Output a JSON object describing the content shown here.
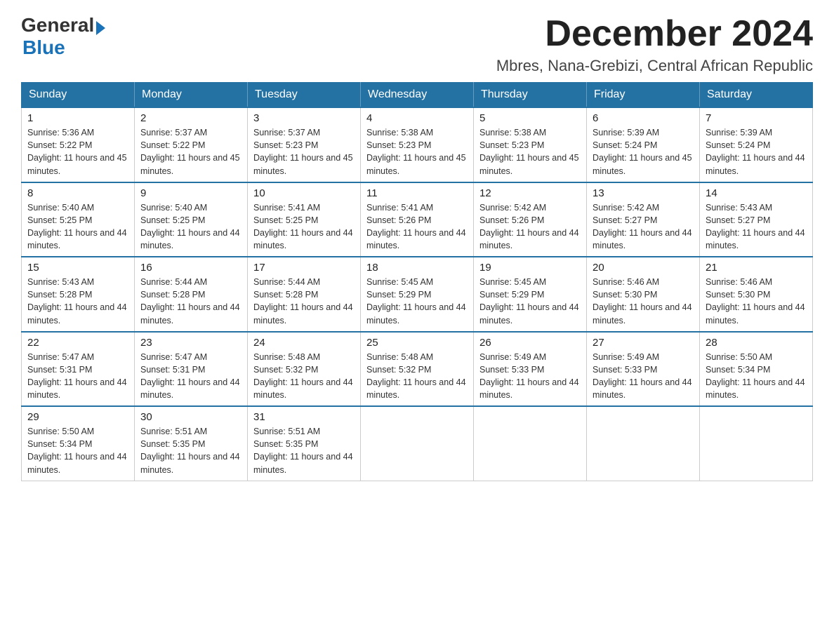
{
  "logo": {
    "general": "General",
    "blue": "Blue"
  },
  "header": {
    "month_year": "December 2024",
    "location": "Mbres, Nana-Grebizi, Central African Republic"
  },
  "days_of_week": [
    "Sunday",
    "Monday",
    "Tuesday",
    "Wednesday",
    "Thursday",
    "Friday",
    "Saturday"
  ],
  "weeks": [
    [
      {
        "day": "1",
        "sunrise": "5:36 AM",
        "sunset": "5:22 PM",
        "daylight": "11 hours and 45 minutes."
      },
      {
        "day": "2",
        "sunrise": "5:37 AM",
        "sunset": "5:22 PM",
        "daylight": "11 hours and 45 minutes."
      },
      {
        "day": "3",
        "sunrise": "5:37 AM",
        "sunset": "5:23 PM",
        "daylight": "11 hours and 45 minutes."
      },
      {
        "day": "4",
        "sunrise": "5:38 AM",
        "sunset": "5:23 PM",
        "daylight": "11 hours and 45 minutes."
      },
      {
        "day": "5",
        "sunrise": "5:38 AM",
        "sunset": "5:23 PM",
        "daylight": "11 hours and 45 minutes."
      },
      {
        "day": "6",
        "sunrise": "5:39 AM",
        "sunset": "5:24 PM",
        "daylight": "11 hours and 45 minutes."
      },
      {
        "day": "7",
        "sunrise": "5:39 AM",
        "sunset": "5:24 PM",
        "daylight": "11 hours and 44 minutes."
      }
    ],
    [
      {
        "day": "8",
        "sunrise": "5:40 AM",
        "sunset": "5:25 PM",
        "daylight": "11 hours and 44 minutes."
      },
      {
        "day": "9",
        "sunrise": "5:40 AM",
        "sunset": "5:25 PM",
        "daylight": "11 hours and 44 minutes."
      },
      {
        "day": "10",
        "sunrise": "5:41 AM",
        "sunset": "5:25 PM",
        "daylight": "11 hours and 44 minutes."
      },
      {
        "day": "11",
        "sunrise": "5:41 AM",
        "sunset": "5:26 PM",
        "daylight": "11 hours and 44 minutes."
      },
      {
        "day": "12",
        "sunrise": "5:42 AM",
        "sunset": "5:26 PM",
        "daylight": "11 hours and 44 minutes."
      },
      {
        "day": "13",
        "sunrise": "5:42 AM",
        "sunset": "5:27 PM",
        "daylight": "11 hours and 44 minutes."
      },
      {
        "day": "14",
        "sunrise": "5:43 AM",
        "sunset": "5:27 PM",
        "daylight": "11 hours and 44 minutes."
      }
    ],
    [
      {
        "day": "15",
        "sunrise": "5:43 AM",
        "sunset": "5:28 PM",
        "daylight": "11 hours and 44 minutes."
      },
      {
        "day": "16",
        "sunrise": "5:44 AM",
        "sunset": "5:28 PM",
        "daylight": "11 hours and 44 minutes."
      },
      {
        "day": "17",
        "sunrise": "5:44 AM",
        "sunset": "5:28 PM",
        "daylight": "11 hours and 44 minutes."
      },
      {
        "day": "18",
        "sunrise": "5:45 AM",
        "sunset": "5:29 PM",
        "daylight": "11 hours and 44 minutes."
      },
      {
        "day": "19",
        "sunrise": "5:45 AM",
        "sunset": "5:29 PM",
        "daylight": "11 hours and 44 minutes."
      },
      {
        "day": "20",
        "sunrise": "5:46 AM",
        "sunset": "5:30 PM",
        "daylight": "11 hours and 44 minutes."
      },
      {
        "day": "21",
        "sunrise": "5:46 AM",
        "sunset": "5:30 PM",
        "daylight": "11 hours and 44 minutes."
      }
    ],
    [
      {
        "day": "22",
        "sunrise": "5:47 AM",
        "sunset": "5:31 PM",
        "daylight": "11 hours and 44 minutes."
      },
      {
        "day": "23",
        "sunrise": "5:47 AM",
        "sunset": "5:31 PM",
        "daylight": "11 hours and 44 minutes."
      },
      {
        "day": "24",
        "sunrise": "5:48 AM",
        "sunset": "5:32 PM",
        "daylight": "11 hours and 44 minutes."
      },
      {
        "day": "25",
        "sunrise": "5:48 AM",
        "sunset": "5:32 PM",
        "daylight": "11 hours and 44 minutes."
      },
      {
        "day": "26",
        "sunrise": "5:49 AM",
        "sunset": "5:33 PM",
        "daylight": "11 hours and 44 minutes."
      },
      {
        "day": "27",
        "sunrise": "5:49 AM",
        "sunset": "5:33 PM",
        "daylight": "11 hours and 44 minutes."
      },
      {
        "day": "28",
        "sunrise": "5:50 AM",
        "sunset": "5:34 PM",
        "daylight": "11 hours and 44 minutes."
      }
    ],
    [
      {
        "day": "29",
        "sunrise": "5:50 AM",
        "sunset": "5:34 PM",
        "daylight": "11 hours and 44 minutes."
      },
      {
        "day": "30",
        "sunrise": "5:51 AM",
        "sunset": "5:35 PM",
        "daylight": "11 hours and 44 minutes."
      },
      {
        "day": "31",
        "sunrise": "5:51 AM",
        "sunset": "5:35 PM",
        "daylight": "11 hours and 44 minutes."
      },
      null,
      null,
      null,
      null
    ]
  ]
}
